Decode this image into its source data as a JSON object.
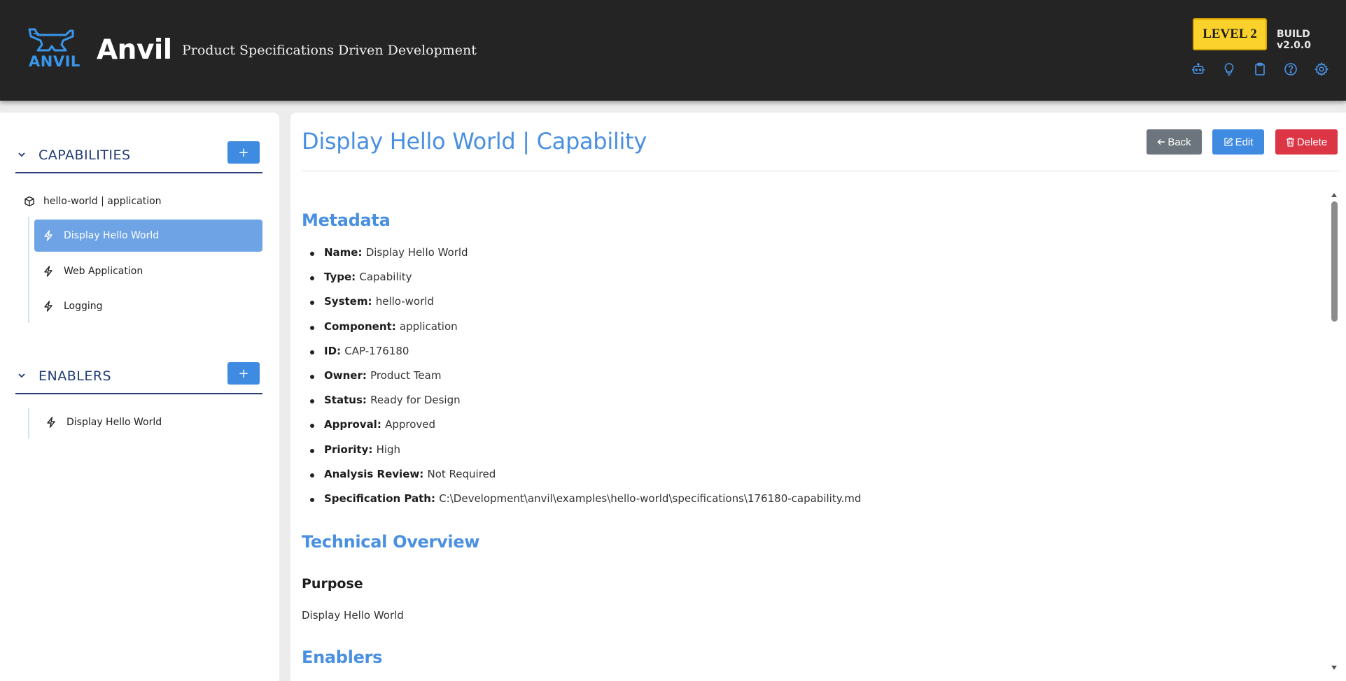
{
  "header": {
    "logo_text": "ANVIL",
    "app_name": "Anvil",
    "tagline": "Product Specifications Driven Development",
    "level_badge": "LEVEL 2",
    "build": "BUILD v2.0.0",
    "icons": [
      "robot-icon",
      "lightbulb-icon",
      "clipboard-icon",
      "help-icon",
      "gear-icon"
    ]
  },
  "sidebar": {
    "capabilities": {
      "title": "CAPABILITIES",
      "add_label": "+",
      "root": "hello-world | application",
      "items": [
        {
          "label": "Display Hello World",
          "active": true
        },
        {
          "label": "Web Application",
          "active": false
        },
        {
          "label": "Logging",
          "active": false
        }
      ]
    },
    "enablers": {
      "title": "ENABLERS",
      "add_label": "+",
      "items": [
        {
          "label": "Display Hello World"
        }
      ]
    }
  },
  "main": {
    "title": "Display Hello World | Capability",
    "buttons": {
      "back": "Back",
      "edit": "Edit",
      "delete": "Delete"
    },
    "metadata_heading": "Metadata",
    "metadata": [
      {
        "key": "Name",
        "value": "Display Hello World"
      },
      {
        "key": "Type",
        "value": "Capability"
      },
      {
        "key": "System",
        "value": "hello-world"
      },
      {
        "key": "Component",
        "value": "application"
      },
      {
        "key": "ID",
        "value": "CAP-176180"
      },
      {
        "key": "Owner",
        "value": "Product Team"
      },
      {
        "key": "Status",
        "value": "Ready for Design"
      },
      {
        "key": "Approval",
        "value": "Approved"
      },
      {
        "key": "Priority",
        "value": "High"
      },
      {
        "key": "Analysis Review",
        "value": "Not Required"
      },
      {
        "key": "Specification Path",
        "value": "C:\\Development\\anvil\\examples\\hello-world\\specifications\\176180-capability.md"
      }
    ],
    "overview_heading": "Technical Overview",
    "purpose_heading": "Purpose",
    "purpose_text": "Display Hello World",
    "enablers_heading": "Enablers"
  },
  "colors": {
    "header_bg": "#242424",
    "accent": "#4a90e0",
    "badge": "#fbd22c",
    "back_btn": "#6c757d",
    "edit_btn": "#3f8be2",
    "delete_btn": "#dc3545",
    "active_item": "#6ea4e6",
    "section_title": "#1f3b73"
  }
}
